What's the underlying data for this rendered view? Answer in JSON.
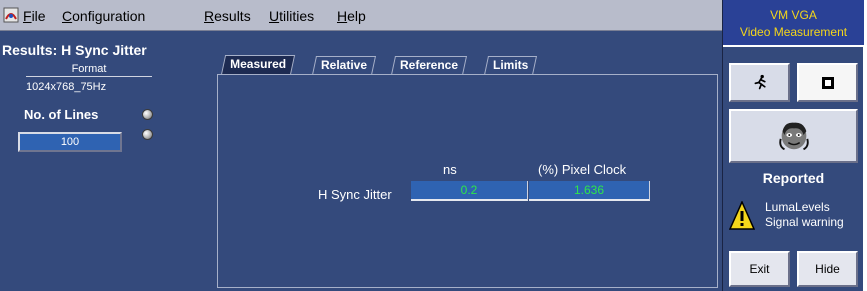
{
  "menubar": {
    "items": [
      {
        "label": "File"
      },
      {
        "label": "Configuration"
      },
      {
        "label": "Results"
      },
      {
        "label": "Utilities"
      },
      {
        "label": "Help"
      }
    ]
  },
  "left": {
    "title": "Results: H Sync Jitter",
    "format_label": "Format",
    "format_value": "1024x768_75Hz",
    "lines_label": "No. of Lines",
    "lines_value": "100"
  },
  "tabs": [
    {
      "label": "Measured",
      "active": true
    },
    {
      "label": "Relative",
      "active": false
    },
    {
      "label": "Reference",
      "active": false
    },
    {
      "label": "Limits",
      "active": false
    }
  ],
  "table": {
    "col_ns": "ns",
    "col_pixel": "(%) Pixel Clock",
    "row_label": "H Sync Jitter",
    "value_ns": "0.2",
    "value_pixel": "1.636"
  },
  "right": {
    "title1": "VM VGA",
    "title2": "Video Measurement",
    "reported": "Reported",
    "warning_line1": "LumaLevels",
    "warning_line2": "Signal warning",
    "exit_label": "Exit",
    "hide_label": "Hide"
  },
  "colors": {
    "panel": "#344a7c",
    "menubar": "#b8bccb",
    "value_text": "#2ee64a",
    "header_text": "#f4d61b"
  },
  "icons": {
    "app_logo": "app-logo-icon",
    "run": "running-man-icon",
    "stop": "stop-icon",
    "face": "face-icon",
    "warning": "warning-icon"
  }
}
